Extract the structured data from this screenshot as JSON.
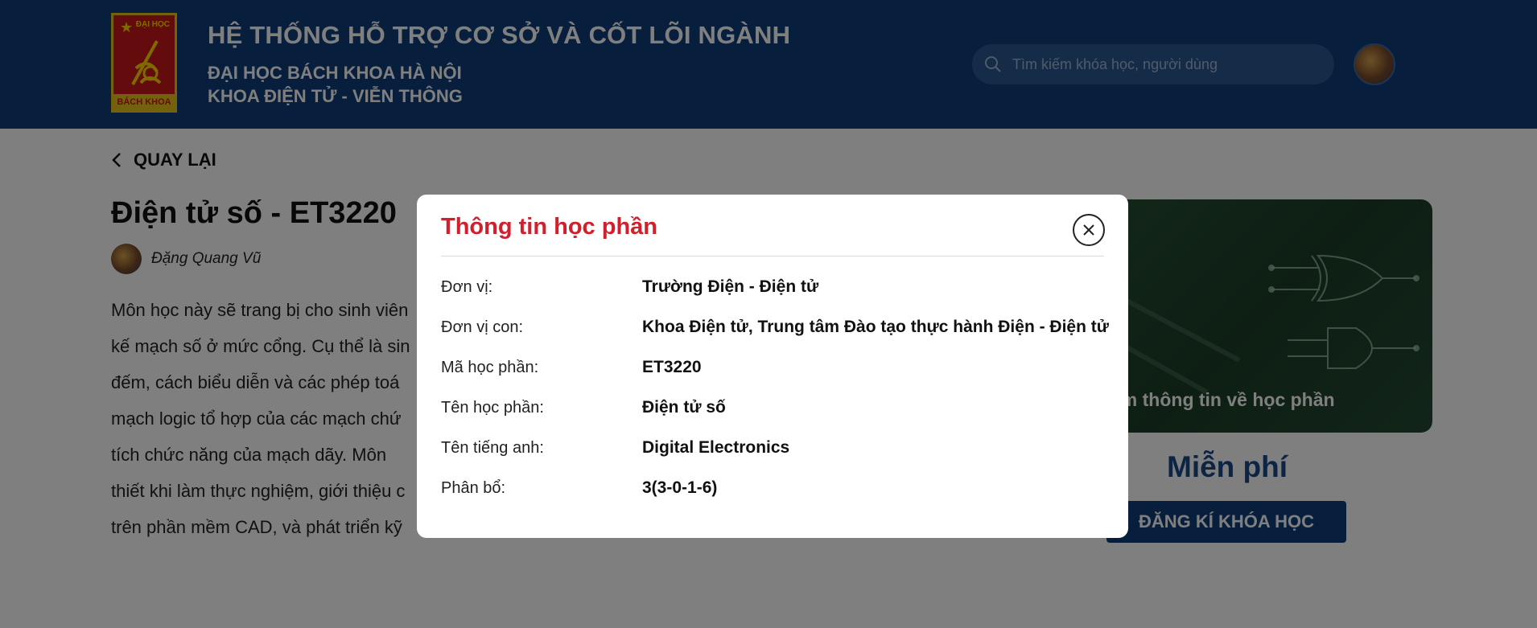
{
  "header": {
    "logo": {
      "top_text": "ĐẠI HỌC",
      "bottom_text": "BÁCH KHOA"
    },
    "title": "HỆ THỐNG HỖ TRỢ CƠ SỞ VÀ CỐT LÕI NGÀNH",
    "subtitle1": "ĐẠI HỌC BÁCH KHOA HÀ NỘI",
    "subtitle2": "KHOA ĐIỆN TỬ - VIỄN THÔNG",
    "search_placeholder": "Tìm kiếm khóa học, người dùng"
  },
  "page": {
    "back_label": "QUAY LẠI",
    "course_title": "Điện tử số - ET3220",
    "author": "Đặng Quang Vũ",
    "description_lines": [
      "Môn học này sẽ trang bị cho sinh viên",
      "kế mạch số ở mức cổng. Cụ thể là sin",
      "đếm, cách biểu diễn và các phép toá",
      "mạch logic tổ hợp của các mạch chứ",
      "tích chức năng của mạch dãy. Môn",
      "thiết khi làm thực nghiệm, giới thiệu c",
      "trên phần mềm CAD, và phát triển kỹ"
    ],
    "card_caption": "em thông tin về học phần",
    "price": "Miễn phí",
    "enroll_label": "ĐĂNG KÍ KHÓA HỌC"
  },
  "modal": {
    "title": "Thông tin học phần",
    "rows": [
      {
        "key": "Đơn vị:",
        "value": "Trường Điện - Điện tử"
      },
      {
        "key": "Đơn vị con:",
        "value": "Khoa Điện tử, Trung tâm Đào tạo thực hành Điện - Điện tử"
      },
      {
        "key": "Mã học phần:",
        "value": "ET3220"
      },
      {
        "key": "Tên học phần:",
        "value": "Điện tử số"
      },
      {
        "key": "Tên tiếng anh:",
        "value": "Digital Electronics"
      },
      {
        "key": "Phân bổ:",
        "value": "3(3-0-1-6)"
      }
    ]
  },
  "colors": {
    "header_bg": "#0f3f7a",
    "modal_title": "#d0202e",
    "price": "#1b4a86",
    "enroll_bg": "#0f3f7a"
  }
}
